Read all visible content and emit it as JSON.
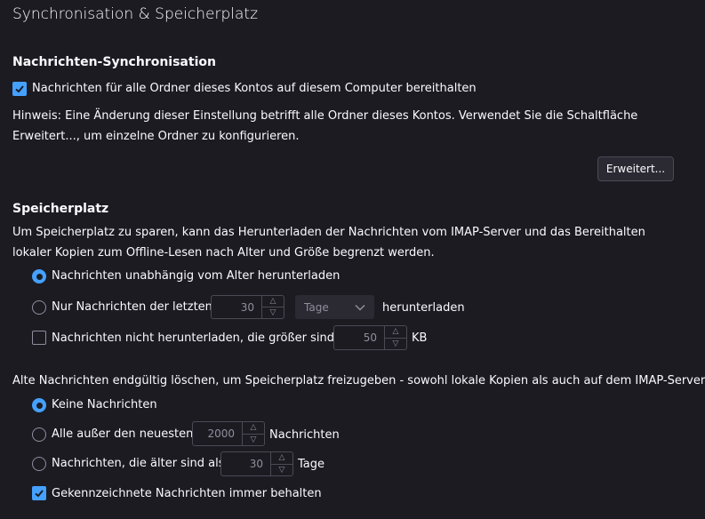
{
  "page": {
    "title": "Synchronisation & Speicherplatz"
  },
  "sync": {
    "heading": "Nachrichten-Synchronisation",
    "keep_messages": {
      "label": "Nachrichten für alle Ordner dieses Kontos auf diesem Computer bereithalten",
      "checked": true
    },
    "hint": "Hinweis: Eine Änderung dieser Einstellung betrifft alle Ordner dieses Kontos. Verwendet Sie die Schaltfläche Erweitert..., um einzelne Ordner zu konfigurieren.",
    "advanced_button": "Erweitert..."
  },
  "storage": {
    "heading": "Speicherplatz",
    "description": "Um Speicherplatz zu sparen, kann das Herunterladen der Nachrichten vom IMAP-Server und das Bereithalten lokaler Kopien zum Offline-Lesen nach Alter und Größe begrenzt werden.",
    "download_all": {
      "label": "Nachrichten unabhängig vom Alter herunterladen",
      "selected": true
    },
    "download_recent": {
      "label": "Nur Nachrichten der letzten",
      "value": "30",
      "unit": "Tage",
      "suffix": "herunterladen",
      "selected": false
    },
    "size_limit": {
      "label": "Nachrichten nicht herunterladen, die größer sind als",
      "value": "50",
      "unit": "KB",
      "checked": false
    }
  },
  "cleanup": {
    "description": "Alte Nachrichten endgültig löschen, um Speicherplatz freizugeben - sowohl lokale Kopien als auch auf dem IMAP-Server:",
    "none": {
      "label": "Keine Nachrichten",
      "selected": true
    },
    "all_except": {
      "label": "Alle außer den neuesten",
      "value": "2000",
      "suffix": "Nachrichten",
      "selected": false
    },
    "older_than": {
      "label": "Nachrichten, die älter sind als",
      "value": "30",
      "suffix": "Tage",
      "selected": false
    },
    "keep_flagged": {
      "label": "Gekennzeichnete Nachrichten immer behalten",
      "checked": true
    }
  },
  "colors": {
    "background": "#1c1b22",
    "accent": "#45a1ff",
    "text": "#fbfbfe",
    "muted": "#8f8f9d"
  },
  "icons": {
    "check": "checkmark-icon",
    "up": "chevron-up-icon",
    "down": "chevron-down-icon"
  }
}
